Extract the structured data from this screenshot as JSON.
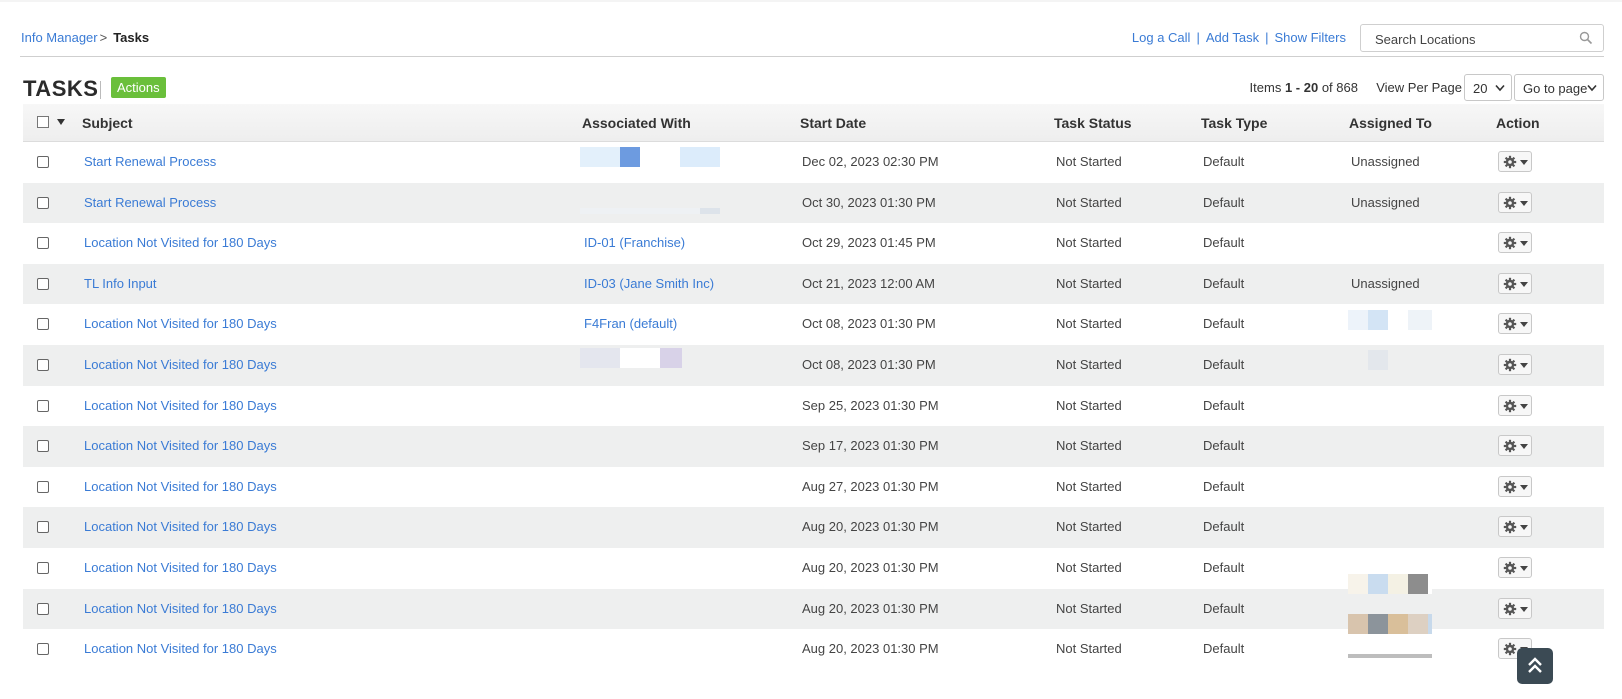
{
  "breadcrumb": {
    "parent": "Info Manager",
    "separator": ">",
    "current": "Tasks"
  },
  "top_links": {
    "log_call": "Log a Call",
    "add_task": "Add Task",
    "show_filters": "Show Filters",
    "pipe": "|"
  },
  "search": {
    "placeholder": "Search Locations",
    "icon": "search-icon"
  },
  "title": "TASKS",
  "actions_label": "Actions",
  "pager": {
    "items_prefix": "Items",
    "range": "1 - 20",
    "of": "of",
    "total": "868",
    "view_per_page_label": "View Per Page",
    "per_page_value": "20",
    "go_to_page": "Go to page"
  },
  "columns": [
    "Subject",
    "Associated With",
    "Start Date",
    "Task Status",
    "Task Type",
    "Assigned To",
    "Action"
  ],
  "rows": [
    {
      "subject": "Start Renewal Process",
      "associated": "",
      "start": "Dec 02, 2023 02:30 PM",
      "status": "Not Started",
      "type": "Default",
      "assigned": "Unassigned"
    },
    {
      "subject": "Start Renewal Process",
      "associated": "",
      "start": "Oct 30, 2023 01:30 PM",
      "status": "Not Started",
      "type": "Default",
      "assigned": "Unassigned"
    },
    {
      "subject": "Location Not Visited for 180 Days",
      "associated": "ID-01 (Franchise)",
      "start": "Oct 29, 2023 01:45 PM",
      "status": "Not Started",
      "type": "Default",
      "assigned": ""
    },
    {
      "subject": "TL Info Input",
      "associated": "ID-03 (Jane Smith Inc)",
      "start": "Oct 21, 2023 12:00 AM",
      "status": "Not Started",
      "type": "Default",
      "assigned": "Unassigned"
    },
    {
      "subject": "Location Not Visited for 180 Days",
      "associated": "F4Fran (default)",
      "start": "Oct 08, 2023 01:30 PM",
      "status": "Not Started",
      "type": "Default",
      "assigned": ""
    },
    {
      "subject": "Location Not Visited for 180 Days",
      "associated": "",
      "start": "Oct 08, 2023 01:30 PM",
      "status": "Not Started",
      "type": "Default",
      "assigned": ""
    },
    {
      "subject": "Location Not Visited for 180 Days",
      "associated": "",
      "start": "Sep 25, 2023 01:30 PM",
      "status": "Not Started",
      "type": "Default",
      "assigned": ""
    },
    {
      "subject": "Location Not Visited for 180 Days",
      "associated": "",
      "start": "Sep 17, 2023 01:30 PM",
      "status": "Not Started",
      "type": "Default",
      "assigned": ""
    },
    {
      "subject": "Location Not Visited for 180 Days",
      "associated": "",
      "start": "Aug 27, 2023 01:30 PM",
      "status": "Not Started",
      "type": "Default",
      "assigned": ""
    },
    {
      "subject": "Location Not Visited for 180 Days",
      "associated": "",
      "start": "Aug 20, 2023 01:30 PM",
      "status": "Not Started",
      "type": "Default",
      "assigned": ""
    },
    {
      "subject": "Location Not Visited for 180 Days",
      "associated": "",
      "start": "Aug 20, 2023 01:30 PM",
      "status": "Not Started",
      "type": "Default",
      "assigned": ""
    },
    {
      "subject": "Location Not Visited for 180 Days",
      "associated": "",
      "start": "Aug 20, 2023 01:30 PM",
      "status": "Not Started",
      "type": "Default",
      "assigned": ""
    },
    {
      "subject": "Location Not Visited for 180 Days",
      "associated": "",
      "start": "Aug 20, 2023 01:30 PM",
      "status": "Not Started",
      "type": "Default",
      "assigned": ""
    }
  ],
  "colors": {
    "link": "#3a7bd5",
    "actions_bg": "#6abf3b",
    "row_alt": "#eeefef",
    "scroll_btn": "#3b4a54"
  },
  "icons": {
    "row_action": "gear-icon",
    "scroll_top": "double-chevron-up-icon"
  }
}
